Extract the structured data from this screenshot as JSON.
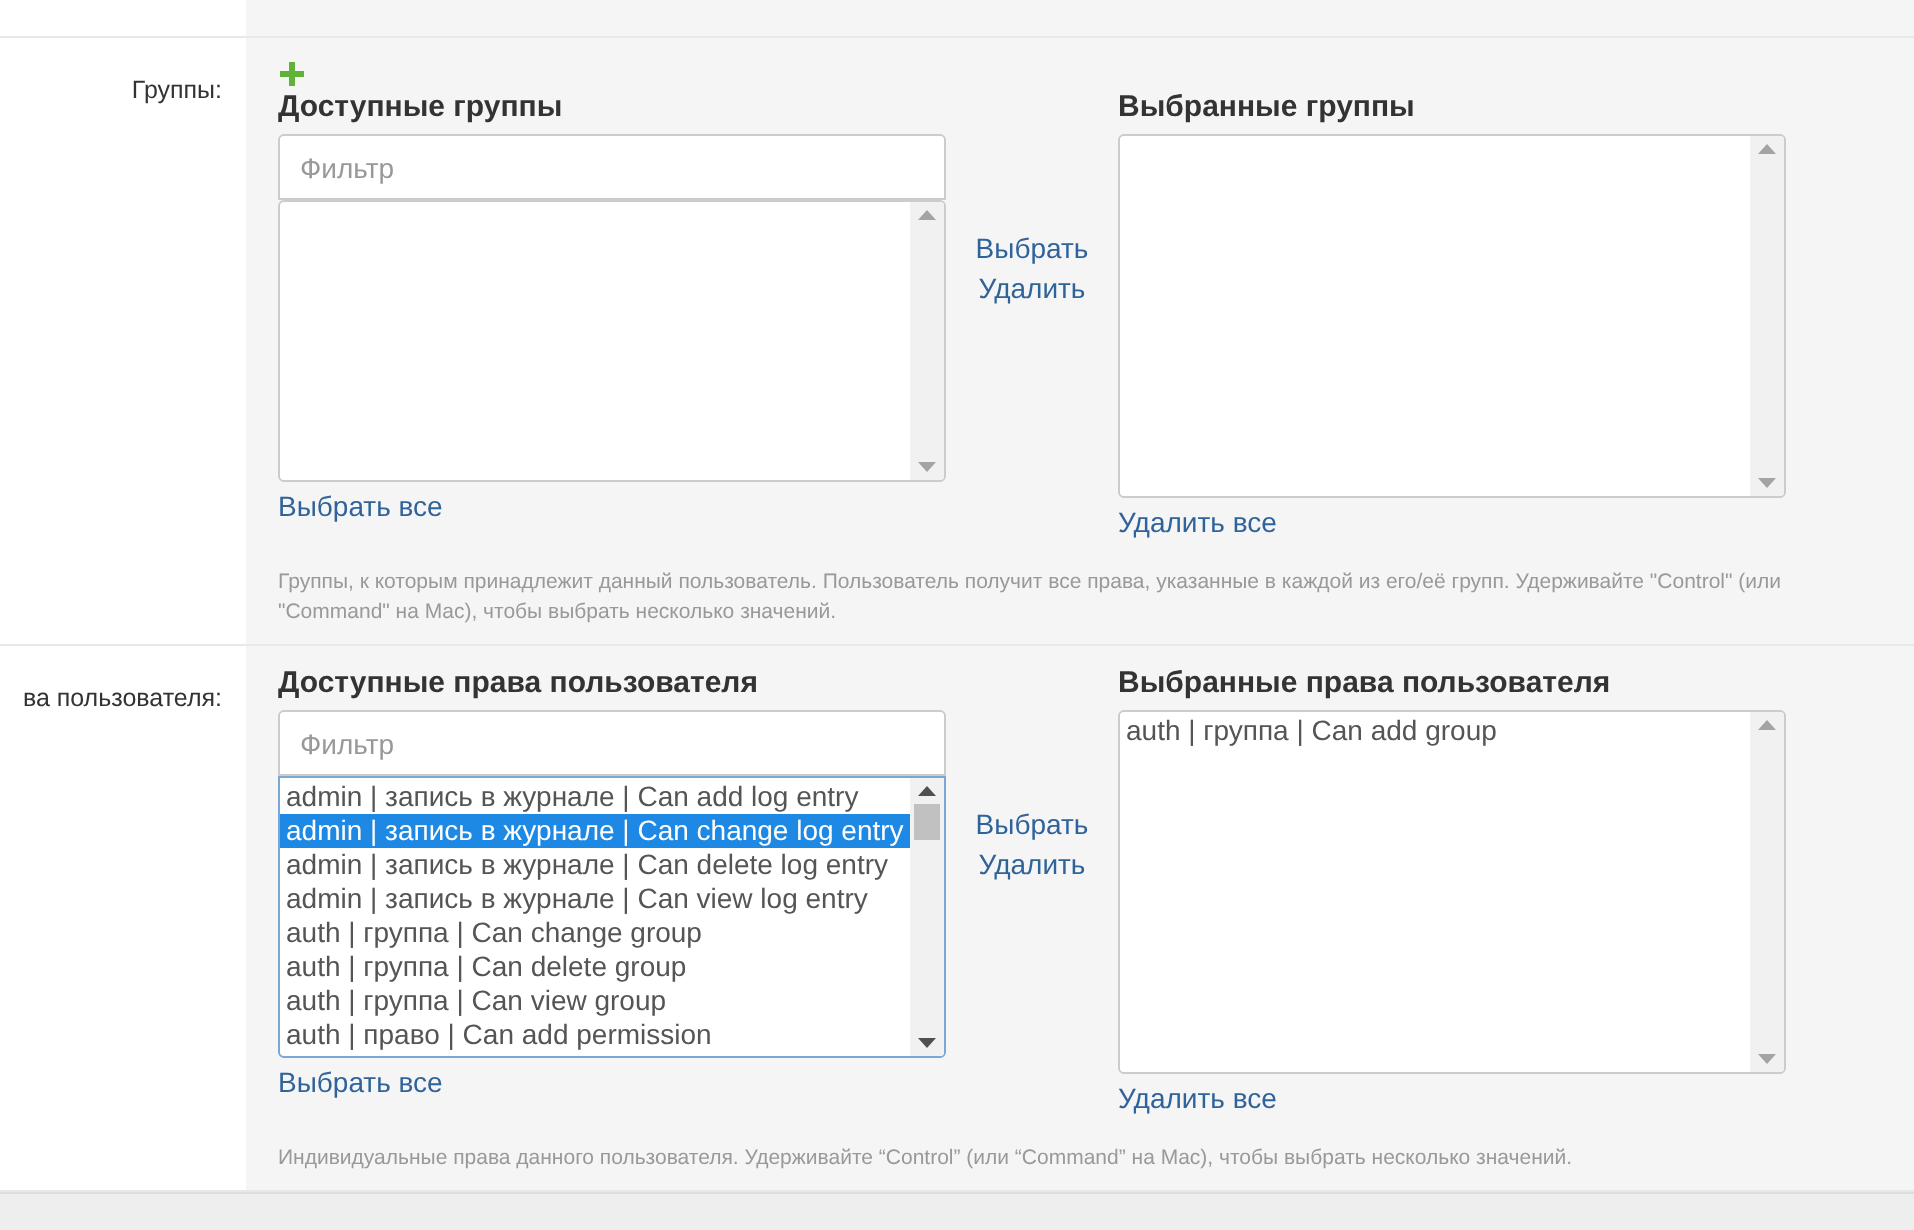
{
  "sections": [
    {
      "label": "Группы:",
      "addable": true,
      "available": {
        "title": "Доступные группы",
        "filter_placeholder": "Фильтр",
        "select_all": "Выбрать все"
      },
      "choose": "Выбрать",
      "remove": "Удалить",
      "chosen": {
        "title": "Выбранные группы",
        "remove_all": "Удалить все"
      },
      "help": "Группы, к которым принадлежит данный пользователь. Пользователь получит все права, указанные в каждой из его/её групп. Удерживайте \"Control\" (или \"Command\" на Mac), чтобы выбрать несколько значений."
    },
    {
      "label": "ва пользователя:",
      "addable": false,
      "available": {
        "title": "Доступные права пользователя",
        "filter_placeholder": "Фильтр",
        "items": [
          {
            "text": "admin | запись в журнале | Can add log entry",
            "selected": false
          },
          {
            "text": "admin | запись в журнале | Can change log entry",
            "selected": true
          },
          {
            "text": "admin | запись в журнале | Can delete log entry",
            "selected": false
          },
          {
            "text": "admin | запись в журнале | Can view log entry",
            "selected": false
          },
          {
            "text": "auth | группа | Can change group",
            "selected": false
          },
          {
            "text": "auth | группа | Can delete group",
            "selected": false
          },
          {
            "text": "auth | группа | Can view group",
            "selected": false
          },
          {
            "text": "auth | право | Can add permission",
            "selected": false
          }
        ],
        "select_all": "Выбрать все"
      },
      "choose": "Выбрать",
      "remove": "Удалить",
      "chosen": {
        "title": "Выбранные права пользователя",
        "items": [
          {
            "text": "auth | группа | Can add group",
            "selected": false
          }
        ],
        "remove_all": "Удалить все"
      },
      "help": "Индивидуальные права данного пользователя. Удерживайте “Control” (или “Command” на Mac), чтобы выбрать несколько значений."
    }
  ]
}
